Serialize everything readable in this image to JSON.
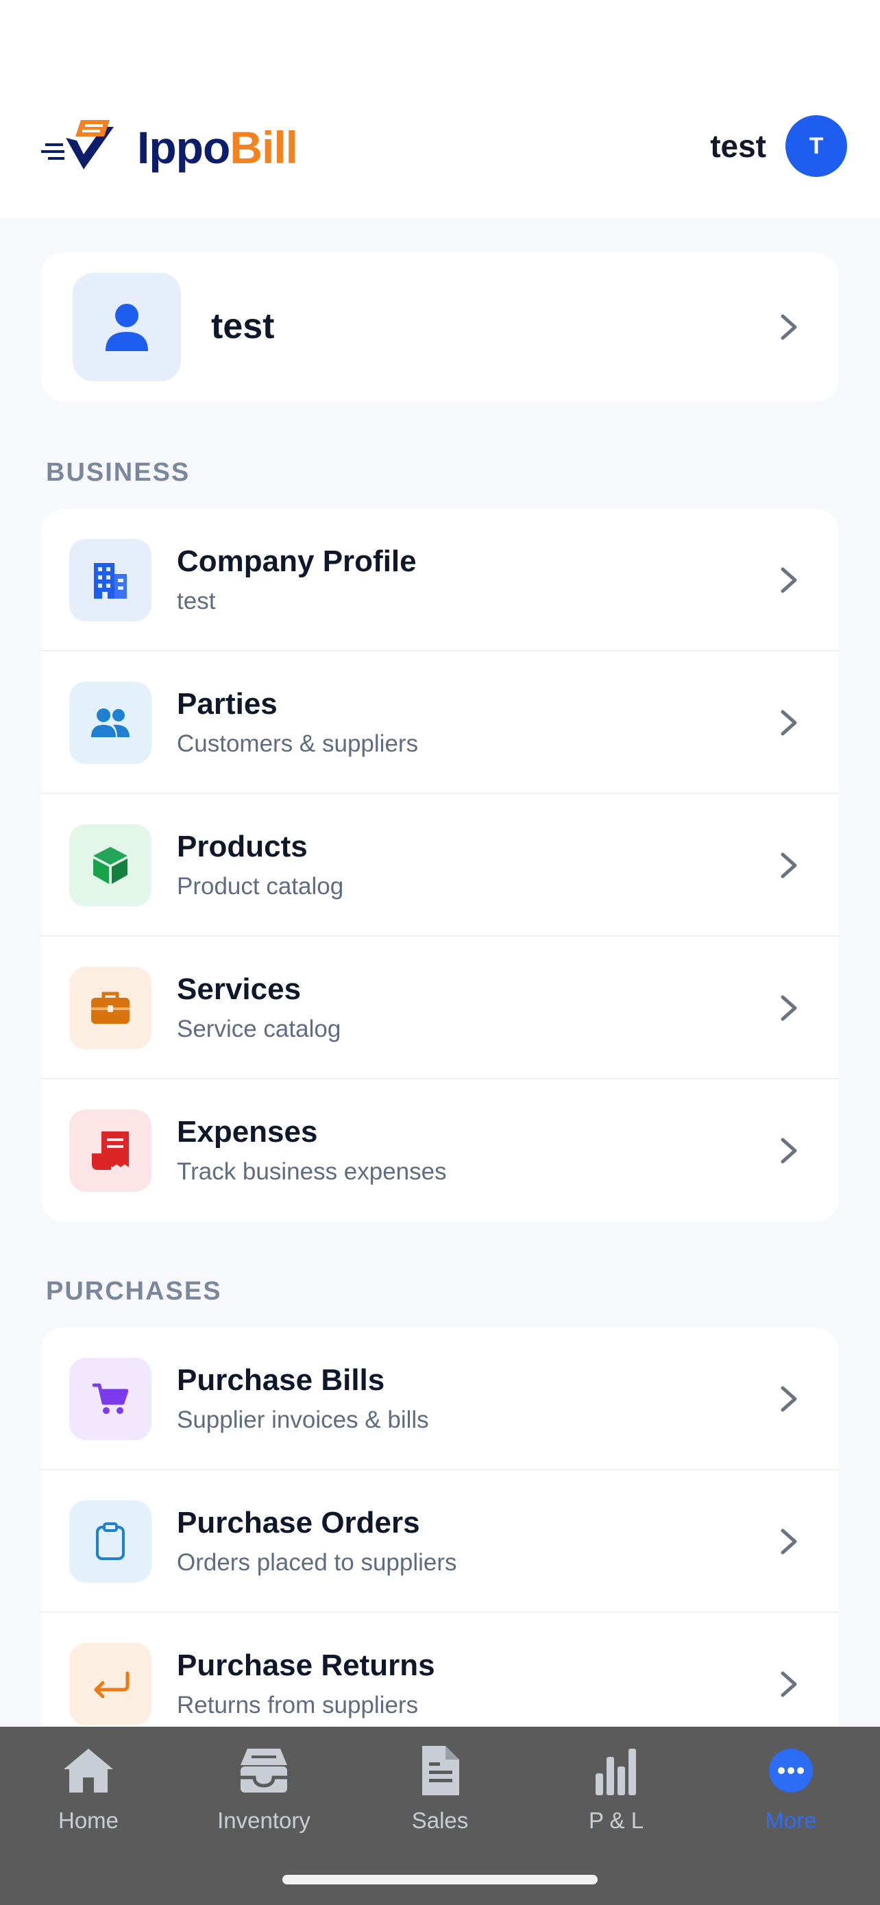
{
  "header": {
    "brand_part1": "Ippo",
    "brand_part2": "Bill",
    "user_name": "test",
    "avatar_initial": "T"
  },
  "profile": {
    "name": "test"
  },
  "sections": {
    "business_label": "BUSINESS",
    "purchases_label": "PURCHASES"
  },
  "business_items": [
    {
      "title": "Company Profile",
      "subtitle": "test",
      "icon": "building-icon"
    },
    {
      "title": "Parties",
      "subtitle": "Customers & suppliers",
      "icon": "people-icon"
    },
    {
      "title": "Products",
      "subtitle": "Product catalog",
      "icon": "cube-icon"
    },
    {
      "title": "Services",
      "subtitle": "Service catalog",
      "icon": "briefcase-icon"
    },
    {
      "title": "Expenses",
      "subtitle": "Track business expenses",
      "icon": "receipt-icon"
    }
  ],
  "purchase_items": [
    {
      "title": "Purchase Bills",
      "subtitle": "Supplier invoices & bills",
      "icon": "cart-icon"
    },
    {
      "title": "Purchase Orders",
      "subtitle": "Orders placed to suppliers",
      "icon": "clipboard-icon"
    },
    {
      "title": "Purchase Returns",
      "subtitle": "Returns from suppliers",
      "icon": "return-arrow-icon"
    }
  ],
  "tabs": [
    {
      "label": "Home",
      "icon": "home-icon"
    },
    {
      "label": "Inventory",
      "icon": "inventory-icon"
    },
    {
      "label": "Sales",
      "icon": "document-icon"
    },
    {
      "label": "P & L",
      "icon": "bar-chart-icon"
    },
    {
      "label": "More",
      "icon": "more-icon",
      "active": true
    }
  ],
  "colors": {
    "accent": "#1d5df0",
    "brand_navy": "#0b1d6b",
    "brand_orange": "#f5821f",
    "active_tab": "#2d6df6"
  }
}
